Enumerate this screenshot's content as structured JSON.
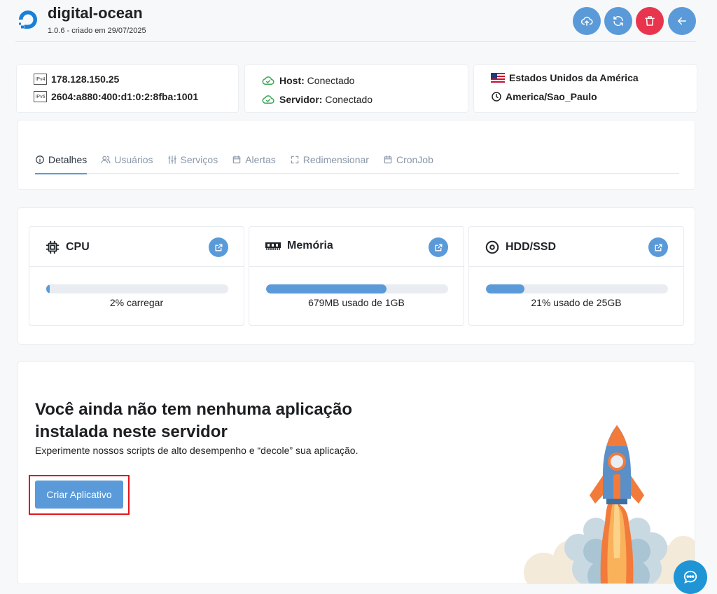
{
  "header": {
    "title": "digital-ocean",
    "subtitle": "1.0.6 - criado em 29/07/2025"
  },
  "colors": {
    "primary": "#5b9ad8",
    "danger": "#e8354d",
    "success": "#3aa757",
    "chat": "#1f95d6"
  },
  "network": {
    "ipv4_badge": "IPv4",
    "ipv6_badge": "IPv6",
    "ipv4": "178.128.150.25",
    "ipv6": "2604:a880:400:d1:0:2:8fba:1001"
  },
  "status": {
    "host_label": "Host:",
    "host_value": "Conectado",
    "server_label": "Servidor:",
    "server_value": "Conectado"
  },
  "location": {
    "country": "Estados Unidos da América",
    "timezone": "America/Sao_Paulo"
  },
  "tabs": [
    {
      "label": "Detalhes",
      "icon": "info-icon",
      "active": true
    },
    {
      "label": "Usuários",
      "icon": "users-icon",
      "active": false
    },
    {
      "label": "Serviços",
      "icon": "sliders-icon",
      "active": false
    },
    {
      "label": "Alertas",
      "icon": "calendar-icon",
      "active": false
    },
    {
      "label": "Redimensionar",
      "icon": "resize-icon",
      "active": false
    },
    {
      "label": "CronJob",
      "icon": "calendar-icon",
      "active": false
    }
  ],
  "resources": [
    {
      "title": "CPU",
      "icon": "cpu-icon",
      "percent": 2,
      "label": "2% carregar"
    },
    {
      "title": "Memória",
      "icon": "memory-icon",
      "percent": 66,
      "label": "679MB usado de 1GB"
    },
    {
      "title": "HDD/SSD",
      "icon": "disk-icon",
      "percent": 21,
      "label": "21% usado de 25GB"
    }
  ],
  "empty": {
    "title": "Você ainda não tem nenhuma aplicação instalada neste servidor",
    "subtitle": "Experimente nossos scripts de alto desempenho e “decole” sua aplicação.",
    "button": "Criar Aplicativo"
  }
}
